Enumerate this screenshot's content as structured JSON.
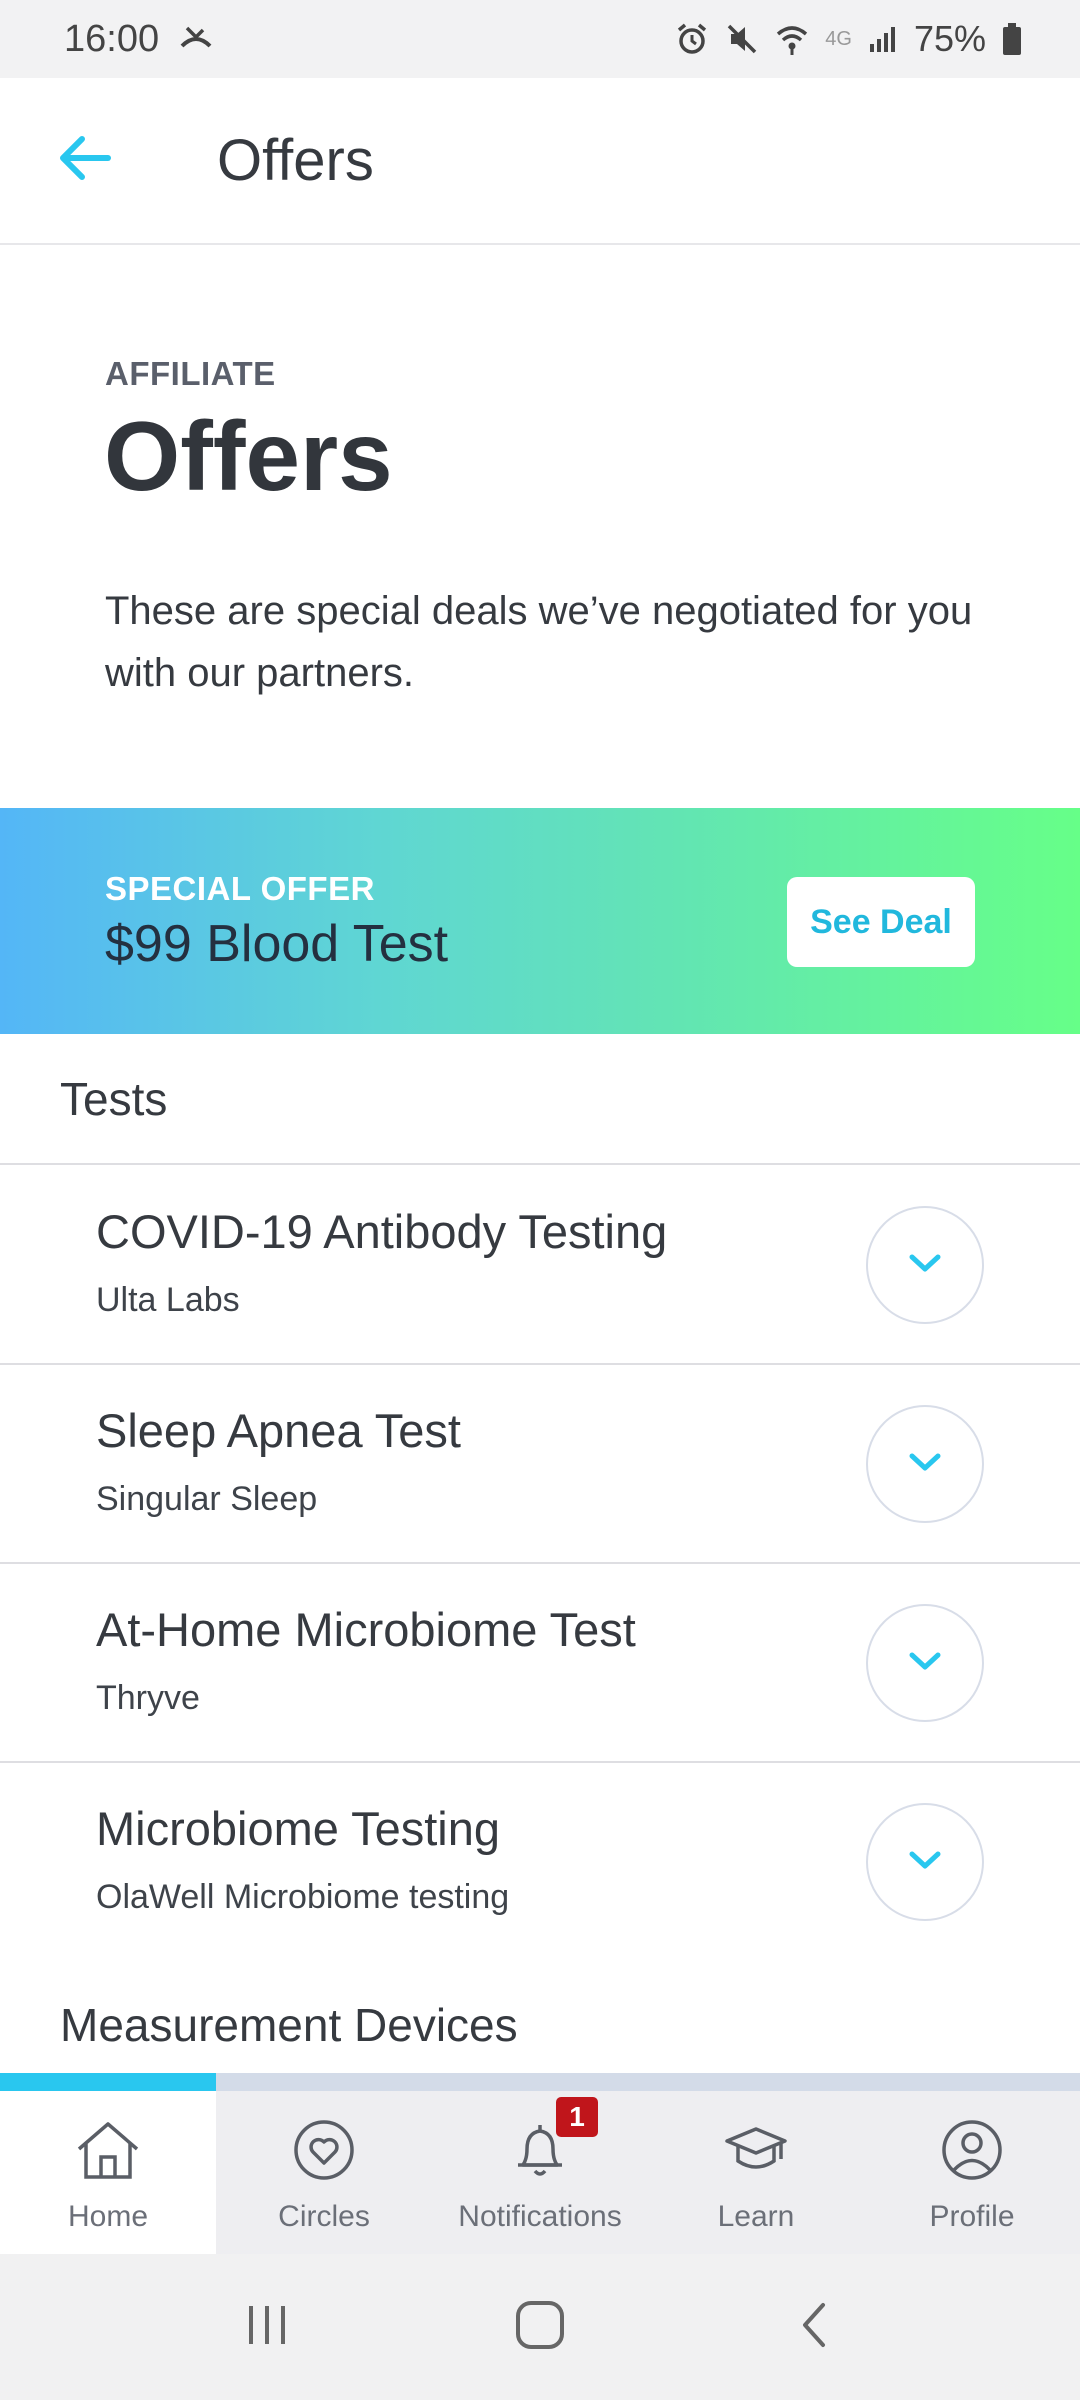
{
  "status_bar": {
    "time": "16:00",
    "network": "4G",
    "battery": "75%"
  },
  "app_bar": {
    "title": "Offers",
    "back_icon": "arrow-left-icon"
  },
  "hero": {
    "eyebrow": "AFFILIATE",
    "title": "Offers",
    "description": "These are special deals we’ve negotiated for you with our partners."
  },
  "promo": {
    "label": "SPECIAL OFFER",
    "title": "$99 Blood Test",
    "button": "See Deal"
  },
  "sections": {
    "tests": "Tests",
    "devices": "Measurement Devices"
  },
  "offers": [
    {
      "title": "COVID-19 Antibody Testing",
      "provider": "Ulta Labs"
    },
    {
      "title": "Sleep Apnea Test",
      "provider": "Singular Sleep"
    },
    {
      "title": "At-Home Microbiome Test",
      "provider": "Thryve"
    },
    {
      "title": "Microbiome Testing",
      "provider": "OlaWell Microbiome testing"
    }
  ],
  "bottom_nav": {
    "items": [
      {
        "label": "Home",
        "icon": "home-icon"
      },
      {
        "label": "Circles",
        "icon": "heart-circle-icon"
      },
      {
        "label": "Notifications",
        "icon": "bell-icon",
        "badge": "1"
      },
      {
        "label": "Learn",
        "icon": "graduation-cap-icon"
      },
      {
        "label": "Profile",
        "icon": "user-circle-icon"
      }
    ]
  },
  "colors": {
    "accent": "#29c7ef",
    "badge": "#c0151b",
    "gradient_start": "#54b6f7",
    "gradient_end": "#66ff88"
  }
}
